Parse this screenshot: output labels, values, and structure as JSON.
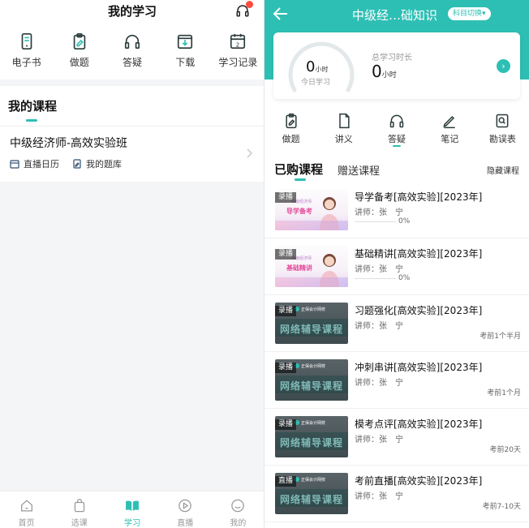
{
  "left": {
    "header": {
      "title": "我的学习"
    },
    "menu": [
      {
        "label": "电子书",
        "icon": "phone-book-icon"
      },
      {
        "label": "做题",
        "icon": "clipboard-edit-icon"
      },
      {
        "label": "答疑",
        "icon": "headphones-icon"
      },
      {
        "label": "下载",
        "icon": "download-icon"
      },
      {
        "label": "学习记录",
        "icon": "calendar-icon"
      }
    ],
    "courses": {
      "section_title": "我的课程",
      "course_name": "中级经济师-高效实验班",
      "links": [
        {
          "label": "直播日历",
          "icon": "calendar-icon"
        },
        {
          "label": "我的题库",
          "icon": "question-bank-icon"
        }
      ]
    },
    "tabbar": [
      {
        "label": "首页",
        "icon": "home-icon",
        "active": false
      },
      {
        "label": "选课",
        "icon": "bag-icon",
        "active": false
      },
      {
        "label": "学习",
        "icon": "book-open-icon",
        "active": true
      },
      {
        "label": "直播",
        "icon": "play-icon",
        "active": false
      },
      {
        "label": "我的",
        "icon": "smile-icon",
        "active": false
      }
    ]
  },
  "right": {
    "header": {
      "title": "中级经…础知识",
      "subject_button": "科目切换"
    },
    "stats": {
      "today_value": "0",
      "today_unit": "小时",
      "today_label": "今日学习",
      "total_label": "总学习时长",
      "total_value": "0",
      "total_unit": "小时"
    },
    "tools": [
      {
        "label": "做题",
        "icon": "clipboard-edit-icon",
        "active": false
      },
      {
        "label": "讲义",
        "icon": "document-icon",
        "active": false
      },
      {
        "label": "答疑",
        "icon": "headphones-icon",
        "active": true
      },
      {
        "label": "笔记",
        "icon": "pen-icon",
        "active": false
      },
      {
        "label": "勘误表",
        "icon": "search-doc-icon",
        "active": false
      }
    ],
    "tabs": {
      "purchased": "已购课程",
      "gifted": "赠送课程",
      "hidden": "隐藏课程"
    },
    "courses": [
      {
        "tag": "录播",
        "thumb": "promo",
        "thumb_text": "导学备考",
        "thumb_small": "中级经济师",
        "title": "导学备考[高效实验][2023年]",
        "teacher": "讲师：张　宁",
        "progress": "0%",
        "exam": ""
      },
      {
        "tag": "录播",
        "thumb": "promo",
        "thumb_text": "基础精讲",
        "thumb_small": "中级经济师",
        "title": "基础精讲[高效实验][2023年]",
        "teacher": "讲师：张　宁",
        "progress": "0%",
        "exam": ""
      },
      {
        "tag": "录播",
        "thumb": "dark",
        "thumb_top": "正保会计网校",
        "thumb_text": "网络辅导课程",
        "title": "习题强化[高效实验][2023年]",
        "teacher": "讲师：张　宁",
        "progress": "",
        "exam": "考前1个半月"
      },
      {
        "tag": "录播",
        "thumb": "dark",
        "thumb_top": "正保会计网校",
        "thumb_text": "网络辅导课程",
        "title": "冲刺串讲[高效实验][2023年]",
        "teacher": "讲师：张　宁",
        "progress": "",
        "exam": "考前1个月"
      },
      {
        "tag": "录播",
        "thumb": "dark",
        "thumb_top": "正保会计网校",
        "thumb_text": "网络辅导课程",
        "title": "模考点评[高效实验][2023年]",
        "teacher": "讲师：张　宁",
        "progress": "",
        "exam": "考前20天"
      },
      {
        "tag": "直播",
        "thumb": "dark",
        "thumb_top": "正保会计网校",
        "thumb_text": "网络辅导课程",
        "title": "考前直播[高效实验][2023年]",
        "teacher": "讲师：张　宁",
        "progress": "",
        "exam": "考前7-10天"
      }
    ]
  },
  "colors": {
    "accent": "#2ebfb4",
    "badge": "#ff4b3e"
  }
}
